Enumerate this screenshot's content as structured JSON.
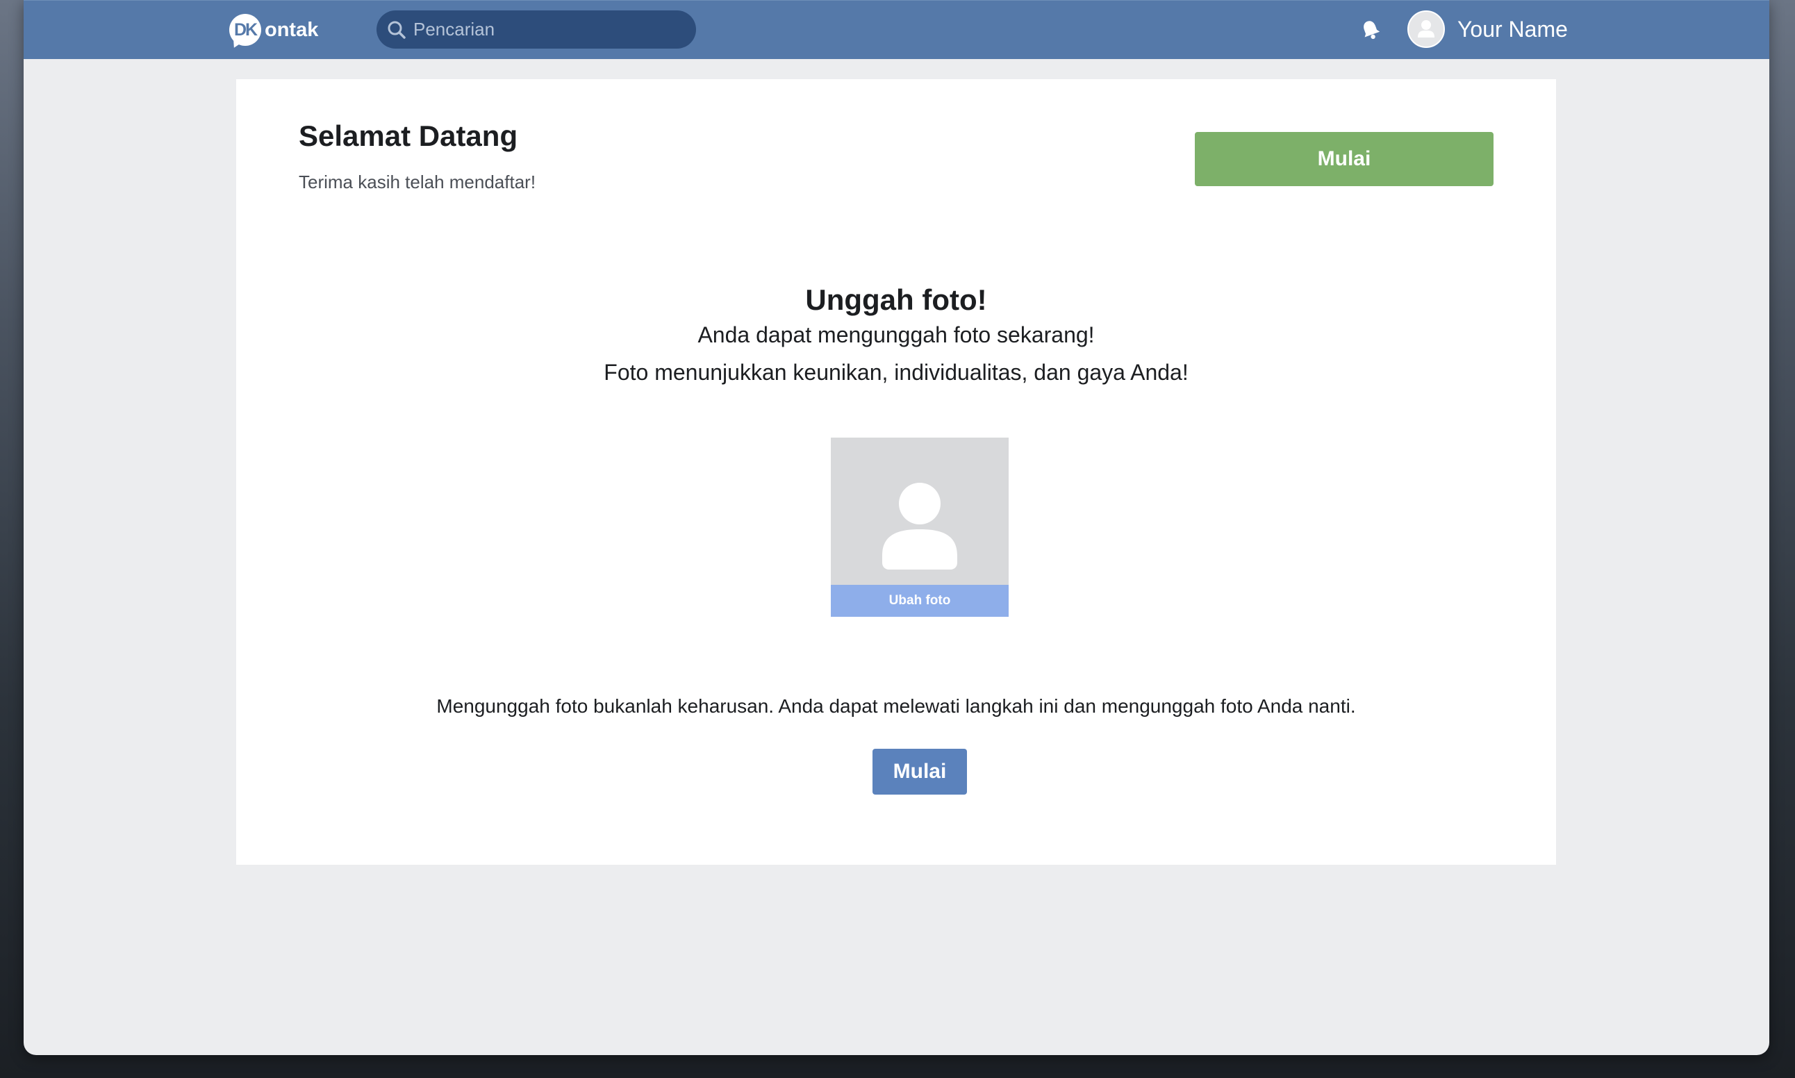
{
  "header": {
    "logo_mark": "DK",
    "logo_text": "ontak",
    "search_placeholder": "Pencarian",
    "user_name": "Your Name",
    "icons": {
      "search": "search-icon",
      "notifications": "bell-icon",
      "avatar": "user-avatar-icon"
    }
  },
  "welcome": {
    "title": "Selamat Datang",
    "subtitle": "Terima kasih telah mendaftar!",
    "start_button": "Mulai"
  },
  "upload": {
    "heading": "Unggah foto!",
    "line1": "Anda dapat mengunggah foto sekarang!",
    "line2": "Foto menunjukkan keunikan, individualitas, dan gaya Anda!",
    "change_photo_button": "Ubah foto",
    "optional_note": "Mengunggah foto bukanlah keharusan. Anda dapat melewati langkah ini dan mengunggah foto Anda nanti.",
    "start_button": "Mulai"
  },
  "colors": {
    "nav_bar": "#5579a9",
    "search_bg": "#2d4d7b",
    "start_top": "#7db069",
    "start_bottom": "#5b82bc",
    "change_photo": "#8eaeea",
    "page_bg": "#ecedef"
  }
}
